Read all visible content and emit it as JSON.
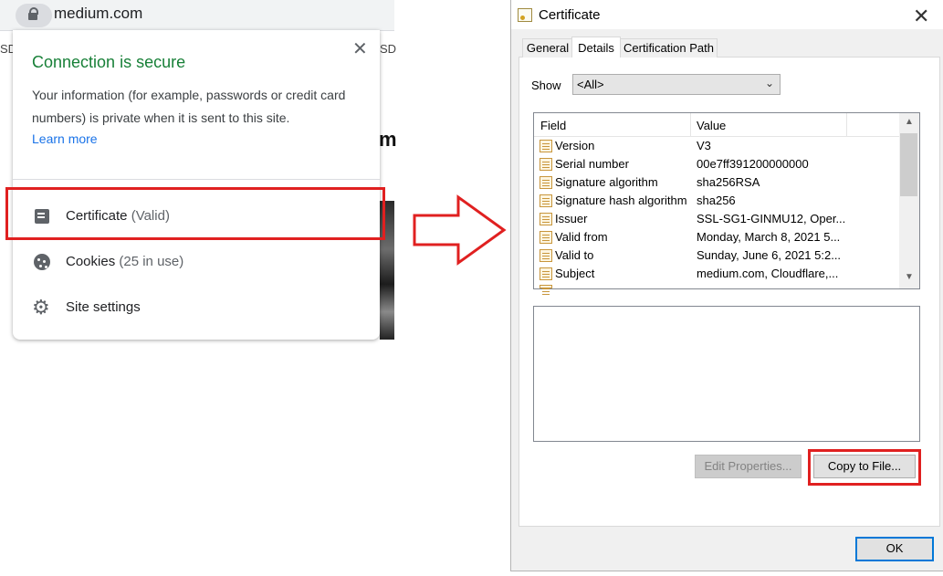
{
  "browser": {
    "url": "medium.com",
    "bg_text_left": "SD",
    "bg_text_right": "SD",
    "bg_heading_fragment": "m"
  },
  "security_popup": {
    "title": "Connection is secure",
    "description": "Your information (for example, passwords or credit card numbers) is private when it is sent to this site.",
    "learn_more": "Learn more",
    "close_glyph": "✕",
    "items": [
      {
        "label": "Certificate",
        "sub": "(Valid)",
        "icon": "certificate-icon"
      },
      {
        "label": "Cookies",
        "sub": "(25 in use)",
        "icon": "cookie-icon"
      },
      {
        "label": "Site settings",
        "sub": "",
        "icon": "gear-icon"
      }
    ],
    "title_color": "#188038",
    "link_color": "#1a73e8"
  },
  "annotation": {
    "highlight_color": "#e02020"
  },
  "certificate_dialog": {
    "title": "Certificate",
    "close_glyph": "✕",
    "tabs": [
      {
        "label": "General",
        "active": false
      },
      {
        "label": "Details",
        "active": true
      },
      {
        "label": "Certification Path",
        "active": false
      }
    ],
    "show_label": "Show",
    "show_value": "<All>",
    "columns": {
      "field": "Field",
      "value": "Value"
    },
    "rows": [
      {
        "field": "Version",
        "value": "V3"
      },
      {
        "field": "Serial number",
        "value": "00e7ff391200000000"
      },
      {
        "field": "Signature algorithm",
        "value": "sha256RSA"
      },
      {
        "field": "Signature hash algorithm",
        "value": "sha256"
      },
      {
        "field": "Issuer",
        "value": "SSL-SG1-GINMU12, Oper..."
      },
      {
        "field": "Valid from",
        "value": "Monday, March 8, 2021 5..."
      },
      {
        "field": "Valid to",
        "value": "Sunday, June 6, 2021 5:2..."
      },
      {
        "field": "Subject",
        "value": "medium.com, Cloudflare,..."
      }
    ],
    "buttons": {
      "edit_properties": "Edit Properties...",
      "copy_to_file": "Copy to File...",
      "ok": "OK"
    }
  }
}
